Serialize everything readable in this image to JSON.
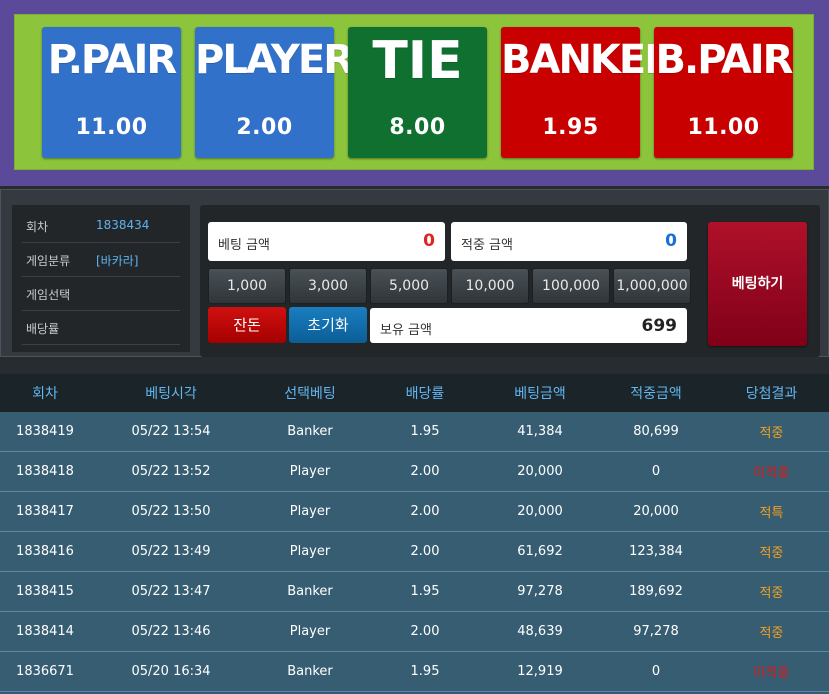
{
  "bets": [
    {
      "name": "P.PAIR",
      "odds": "11.00",
      "color": "#3271c9"
    },
    {
      "name": "PLAYER",
      "odds": "2.00",
      "color": "#3271c9"
    },
    {
      "name": "TIE",
      "odds": "8.00",
      "color": "#0f7030"
    },
    {
      "name": "BANKER",
      "odds": "1.95",
      "color": "#c90000"
    },
    {
      "name": "B.PAIR",
      "odds": "11.00",
      "color": "#c90000"
    }
  ],
  "info": {
    "round_label": "회차",
    "round_value": "1838434",
    "category_label": "게임분류",
    "category_value": "[바카라]",
    "selection_label": "게임선택",
    "selection_value": "",
    "rate_label": "배당률",
    "rate_value": ""
  },
  "betting": {
    "bet_amount_label": "베팅 금액",
    "bet_amount_value": "0",
    "win_amount_label": "적중 금액",
    "win_amount_value": "0",
    "chips": [
      "1,000",
      "3,000",
      "5,000",
      "10,000",
      "100,000",
      "1,000,000"
    ],
    "change_label": "잔돈",
    "reset_label": "초기화",
    "balance_label": "보유 금액",
    "balance_value": "699",
    "place_label": "베팅하기"
  },
  "history": {
    "headers": [
      "회차",
      "베팅시각",
      "선택베팅",
      "배당률",
      "베팅금액",
      "적중금액",
      "당첨결과"
    ],
    "rows": [
      {
        "round": "1838419",
        "time": "05/22 13:54",
        "pick": "Banker",
        "rate": "1.95",
        "bet": "41,384",
        "win": "80,699",
        "result": "적중",
        "status": "win"
      },
      {
        "round": "1838418",
        "time": "05/22 13:52",
        "pick": "Player",
        "rate": "2.00",
        "bet": "20,000",
        "win": "0",
        "result": "미적중",
        "status": "pending"
      },
      {
        "round": "1838417",
        "time": "05/22 13:50",
        "pick": "Player",
        "rate": "2.00",
        "bet": "20,000",
        "win": "20,000",
        "result": "적특",
        "status": "win"
      },
      {
        "round": "1838416",
        "time": "05/22 13:49",
        "pick": "Player",
        "rate": "2.00",
        "bet": "61,692",
        "win": "123,384",
        "result": "적중",
        "status": "win"
      },
      {
        "round": "1838415",
        "time": "05/22 13:47",
        "pick": "Banker",
        "rate": "1.95",
        "bet": "97,278",
        "win": "189,692",
        "result": "적중",
        "status": "win"
      },
      {
        "round": "1838414",
        "time": "05/22 13:46",
        "pick": "Player",
        "rate": "2.00",
        "bet": "48,639",
        "win": "97,278",
        "result": "적중",
        "status": "win"
      },
      {
        "round": "1836671",
        "time": "05/20 16:34",
        "pick": "Banker",
        "rate": "1.95",
        "bet": "12,919",
        "win": "0",
        "result": "미적중",
        "status": "pending"
      }
    ]
  }
}
